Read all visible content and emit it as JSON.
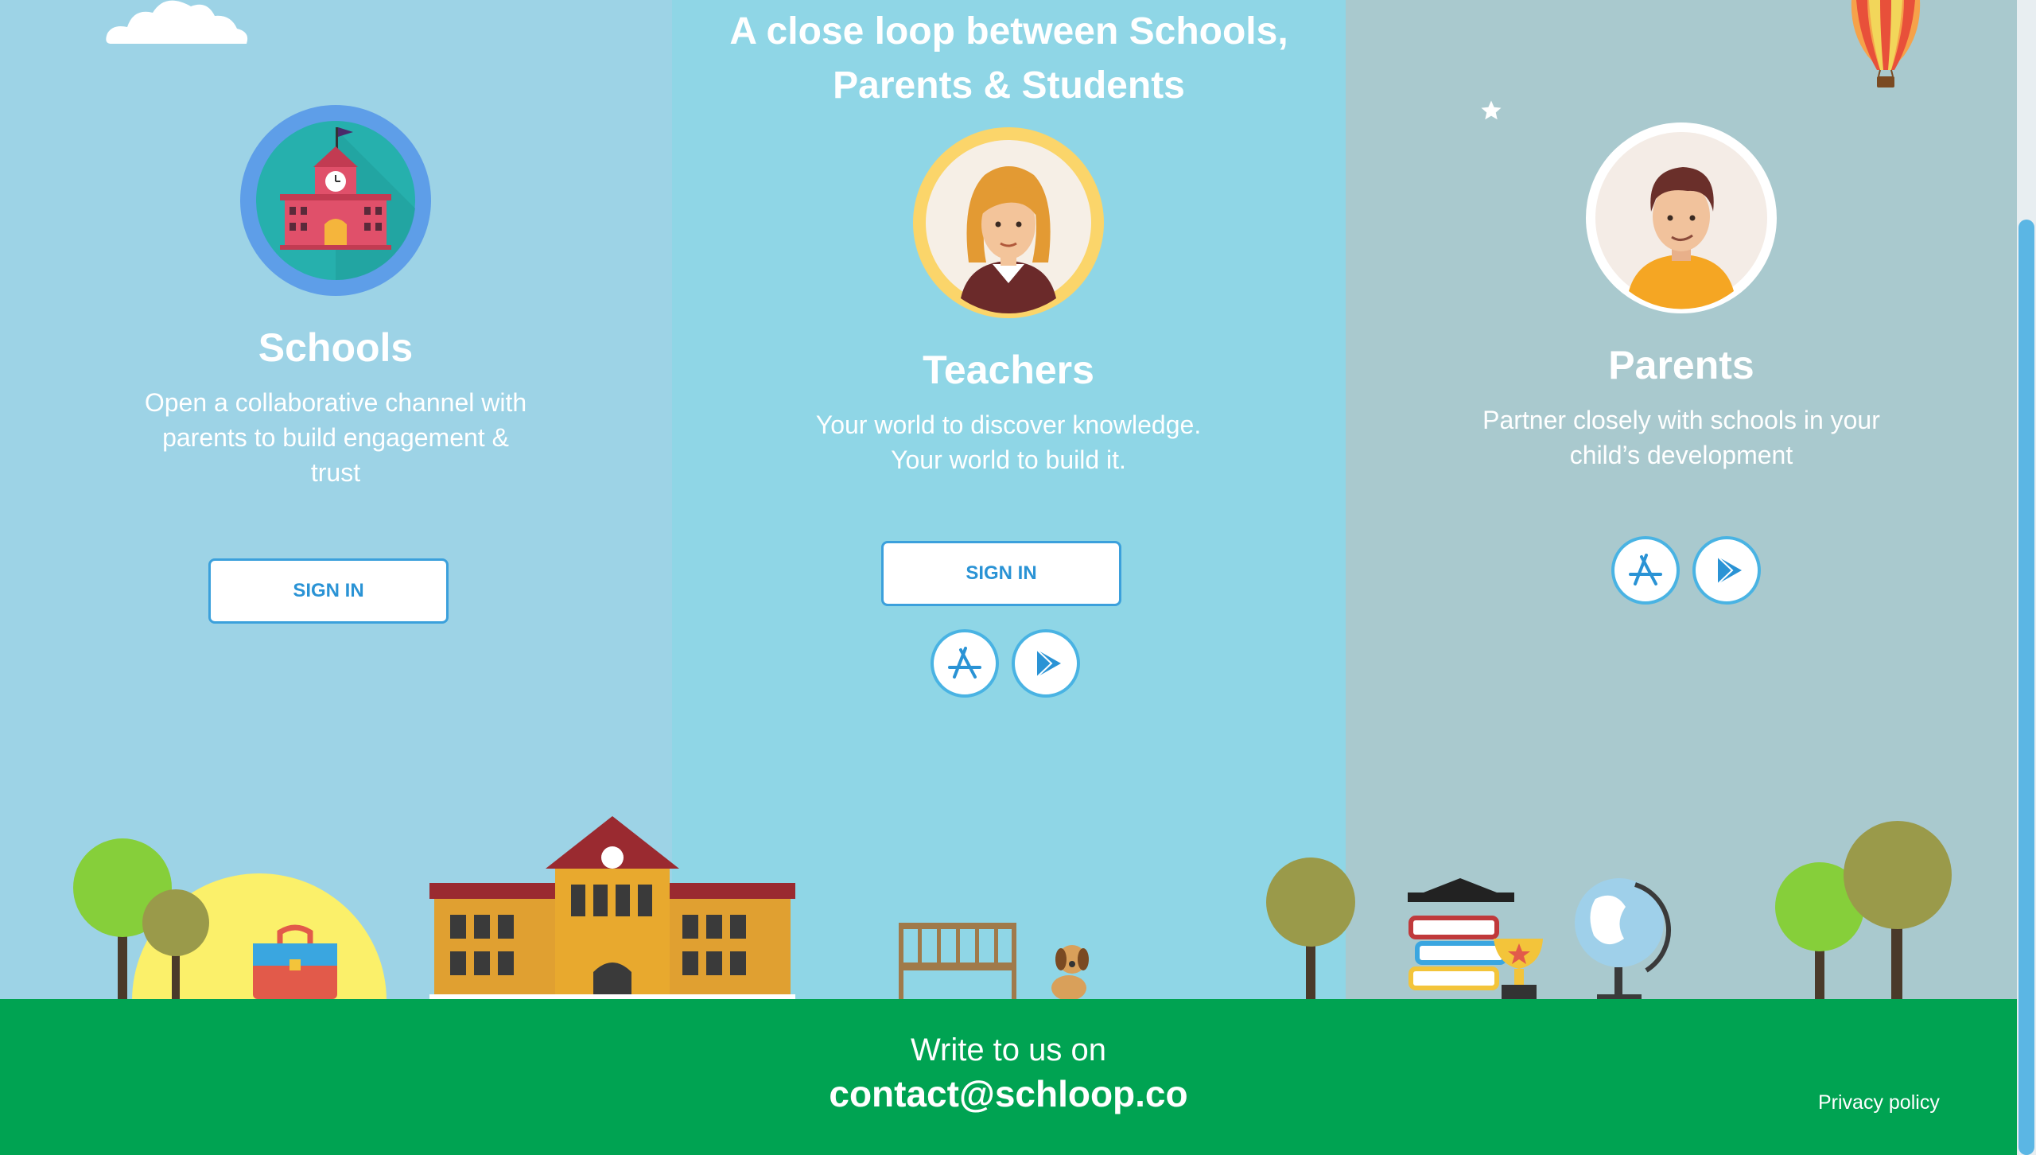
{
  "headline": {
    "line1": "A close loop between Schools,",
    "line2": "Parents & Students"
  },
  "cards": [
    {
      "title": "Schools",
      "desc": [
        "Open a collaborative channel with",
        "parents to build engagement &",
        "trust"
      ],
      "signin_label": "SIGN IN",
      "icon": "school-building-icon"
    },
    {
      "title": "Teachers",
      "desc": [
        "Your world to discover knowledge.",
        "Your world to build it."
      ],
      "signin_label": "SIGN IN",
      "icon": "teacher-avatar-icon"
    },
    {
      "title": "Parents",
      "desc": [
        "Partner closely with schools in your",
        "child’s development"
      ],
      "icon": "parent-avatar-icon"
    }
  ],
  "store_icons": {
    "app_store": "app-store-icon",
    "play_store": "play-store-icon"
  },
  "footer": {
    "write_label": "Write to us on",
    "email": "contact@schloop.co",
    "privacy_label": "Privacy policy"
  },
  "colors": {
    "footer_green": "#00a352",
    "accent_blue": "#3ba0dc",
    "col_left": "#9dd3e6",
    "col_mid": "#8fd6e6",
    "col_right": "#a9c9ce"
  }
}
